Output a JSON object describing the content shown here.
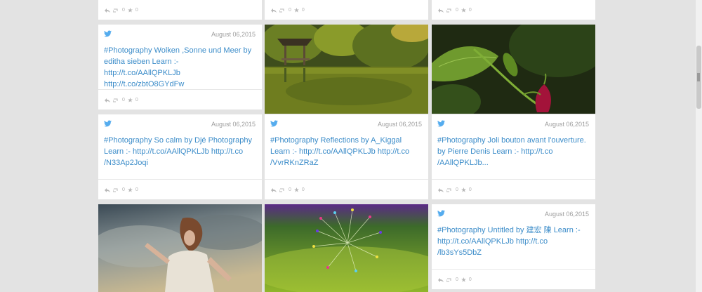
{
  "cards": [
    {
      "id": "c1",
      "date": "August 06,2015",
      "text": "#Photography Wolken ,Sonne und Meer by editha sieben Learn :- http://t.co/AAllQPKLJb http://t.co/zbtO8GYdFw",
      "counts": {
        "retweets": "0",
        "favorites": "0"
      }
    },
    {
      "id": "c2",
      "date": "August 06,2015",
      "text": "#Photography So calm by Djé Photography Learn :- http://t.co/AAllQPKLJb http://t.co /N33Ap2Joqi",
      "counts": {
        "retweets": "0",
        "favorites": "0"
      }
    },
    {
      "id": "c3",
      "date": "August 06,2015",
      "text": "#Photography Reflections by A_Kiggal Learn :- http://t.co/AAllQPKLJb http://t.co /VvrRKnZRaZ",
      "counts": {
        "retweets": "0",
        "favorites": "0"
      }
    },
    {
      "id": "c4",
      "date": "August 06,2015",
      "text": "#Photography Joli bouton avant l'ouverture. by Pierre Denis Learn :- http://t.co /AAllQPKLJb...",
      "counts": {
        "retweets": "0",
        "favorites": "0"
      }
    },
    {
      "id": "c5",
      "date": "August 06,2015",
      "text": "#Photography Untitled by 建宏 陳 Learn :- http://t.co/AAllQPKLJb http://t.co /lb3sYs5DbZ",
      "counts": {
        "retweets": "0",
        "favorites": "0"
      }
    }
  ],
  "top_row_counts": {
    "retweets": "0",
    "favorites": "0"
  },
  "colors": {
    "link": "#3b8cc9",
    "twitter": "#55acee",
    "background": "#e3e3e3"
  }
}
